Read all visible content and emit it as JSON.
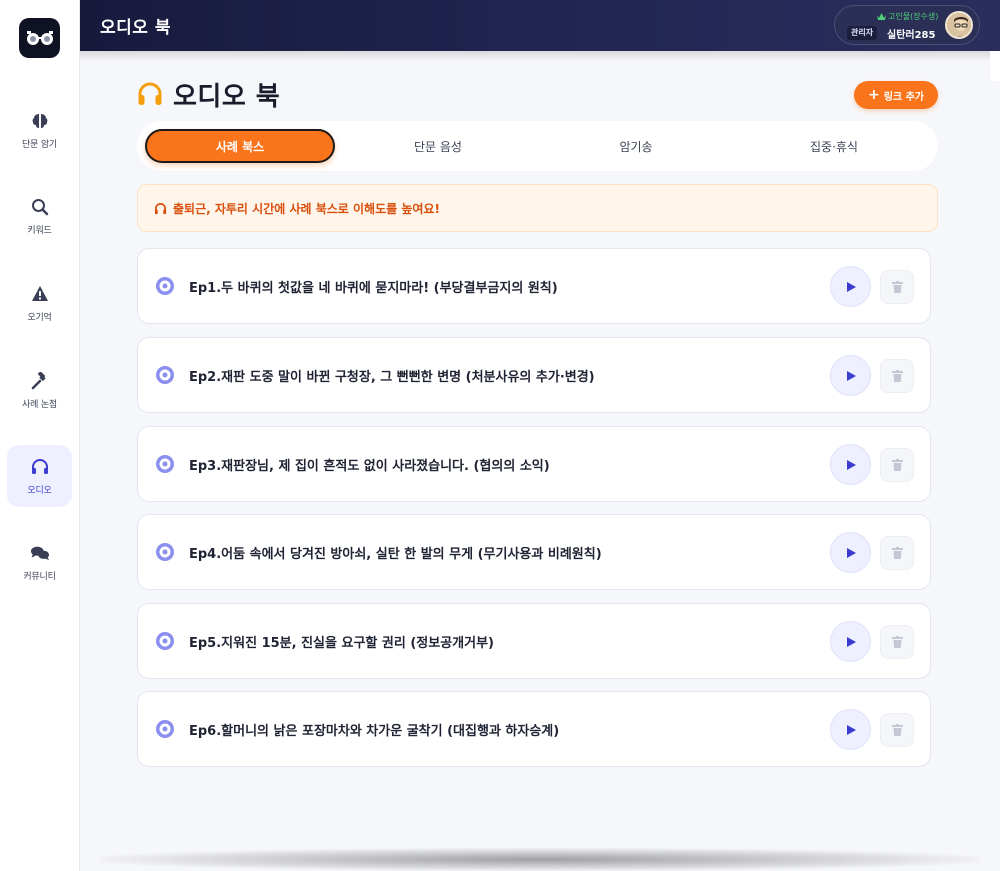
{
  "app": {
    "title": "오디오 북"
  },
  "user": {
    "rank": "고인물(장수생)",
    "role": "관리자",
    "name": "실탄러285"
  },
  "sidebar": {
    "items": [
      {
        "label": "단문 암기",
        "icon": "brain-icon",
        "active": false
      },
      {
        "label": "키워드",
        "icon": "search-icon",
        "active": false
      },
      {
        "label": "오기억",
        "icon": "warning-icon",
        "active": false
      },
      {
        "label": "사례 논점",
        "icon": "gavel-icon",
        "active": false
      },
      {
        "label": "오디오",
        "icon": "headphones-icon",
        "active": true
      },
      {
        "label": "커뮤니티",
        "icon": "chat-icon",
        "active": false
      }
    ]
  },
  "main": {
    "title": "오디오 북",
    "add_button": "링크 추가",
    "tabs": [
      {
        "label": "사례 북스",
        "active": true
      },
      {
        "label": "단문 음성",
        "active": false
      },
      {
        "label": "암기송",
        "active": false
      },
      {
        "label": "집중·휴식",
        "active": false
      }
    ],
    "notice": "출퇴근, 자투리 시간에 사례 북스로 이해도를 높여요!",
    "episodes": [
      "Ep1.두 바퀴의 첫값을 네 바퀴에 묻지마라! (부당결부금지의 원칙)",
      "Ep2.재판 도중 말이 바뀐 구청장, 그 뻔뻔한 변명 (처분사유의 추가·변경)",
      "Ep3.재판장님, 제 집이 흔적도 없이 사라졌습니다. (협의의 소익)",
      "Ep4.어둠 속에서 당겨진 방아쇠, 실탄 한 발의 무게 (무기사용과 비례원칙)",
      "Ep5.지워진 15분, 진실을 요구할 권리 (정보공개거부)",
      "Ep6.할머니의 낡은 포장마차와 차가운 굴착기 (대집행과 하자승계)"
    ]
  },
  "colors": {
    "accent": "#f9741a",
    "indigo": "#3c3ccf",
    "topbar": "#1c1f45"
  }
}
